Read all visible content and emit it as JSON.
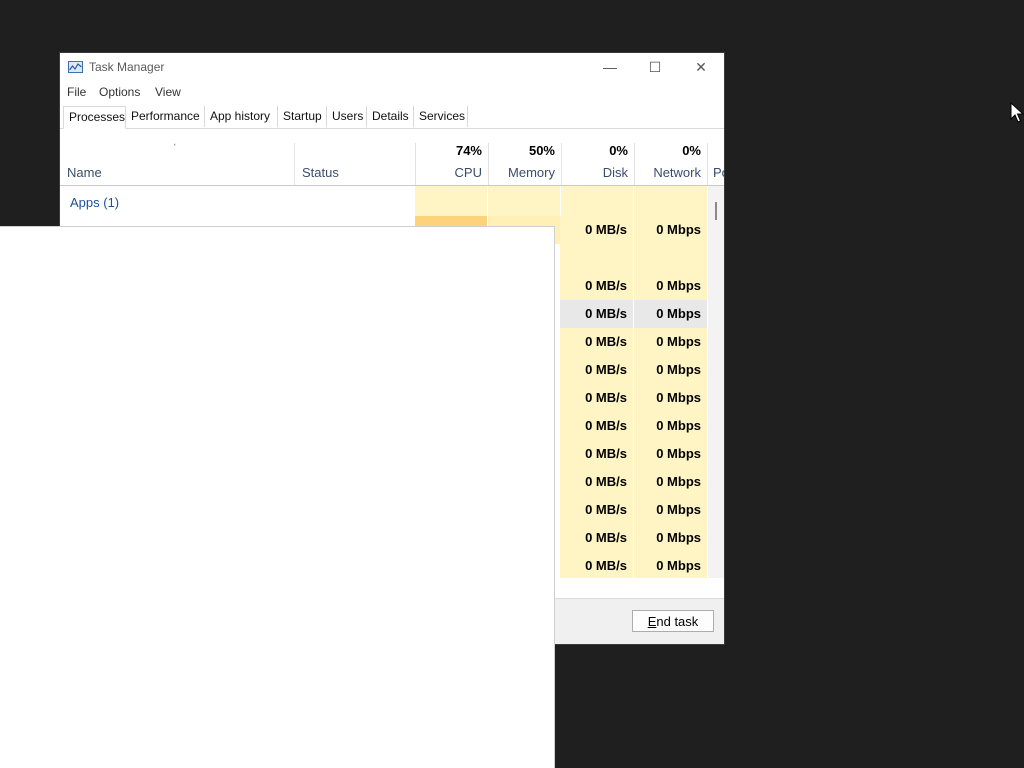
{
  "window": {
    "title": "Task Manager",
    "icon": "task-manager-icon",
    "controls": {
      "minimize": "—",
      "maximize": "☐",
      "close": "✕"
    }
  },
  "menu": [
    "File",
    "Options",
    "View"
  ],
  "tabs": [
    "Processes",
    "Performance",
    "App history",
    "Startup",
    "Users",
    "Details",
    "Services"
  ],
  "active_tab": "Processes",
  "columns": {
    "sort_indicator": "ˈ",
    "name": "Name",
    "status": "Status",
    "cpu": {
      "percent": "74%",
      "label": "CPU"
    },
    "memory": {
      "percent": "50%",
      "label": "Memory"
    },
    "disk": {
      "percent": "0%",
      "label": "Disk"
    },
    "network": {
      "percent": "0%",
      "label": "Network"
    },
    "power_partial": "Po"
  },
  "group": {
    "label": "Apps (1)"
  },
  "rows": [
    {
      "disk": "0 MB/s",
      "network": "0 Mbps"
    },
    {
      "disk": "",
      "network": ""
    },
    {
      "disk": "0 MB/s",
      "network": "0 Mbps"
    },
    {
      "disk": "0 MB/s",
      "network": "0 Mbps",
      "highlighted": true
    },
    {
      "disk": "0 MB/s",
      "network": "0 Mbps"
    },
    {
      "disk": "0 MB/s",
      "network": "0 Mbps"
    },
    {
      "disk": "0 MB/s",
      "network": "0 Mbps"
    },
    {
      "disk": "0 MB/s",
      "network": "0 Mbps"
    },
    {
      "disk": "0 MB/s",
      "network": "0 Mbps"
    },
    {
      "disk": "0 MB/s",
      "network": "0 Mbps"
    },
    {
      "disk": "0 MB/s",
      "network": "0 Mbps"
    },
    {
      "disk": "0 MB/s",
      "network": "0 Mbps"
    },
    {
      "disk": "0 MB/s",
      "network": "0 Mbps"
    }
  ],
  "footer": {
    "end_task_prefix": "E",
    "end_task_rest": "nd task"
  },
  "colors": {
    "accent": "#1b4fa0",
    "cpu_heat": "#fcd37a",
    "cell_heat": "#fff4c4",
    "desktop": "#1f1f1f"
  }
}
